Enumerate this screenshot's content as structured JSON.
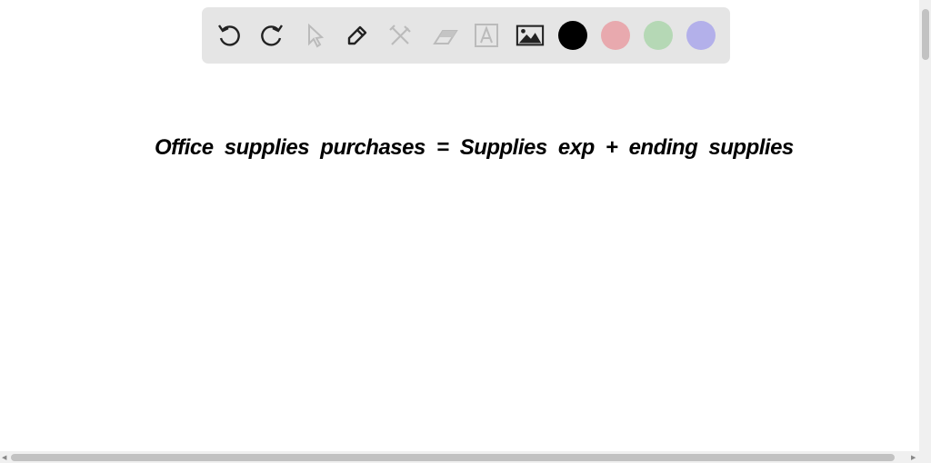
{
  "toolbar": {
    "tools": [
      "undo",
      "redo",
      "select",
      "pen",
      "tools",
      "eraser",
      "text",
      "image"
    ],
    "colors": [
      "#000000",
      "#e8a9ae",
      "#b5d8b5",
      "#b3b0ea"
    ],
    "selected_color": "#000000"
  },
  "canvas": {
    "handwriting": "Office supplies purchases = Supplies exp + ending supplies"
  }
}
